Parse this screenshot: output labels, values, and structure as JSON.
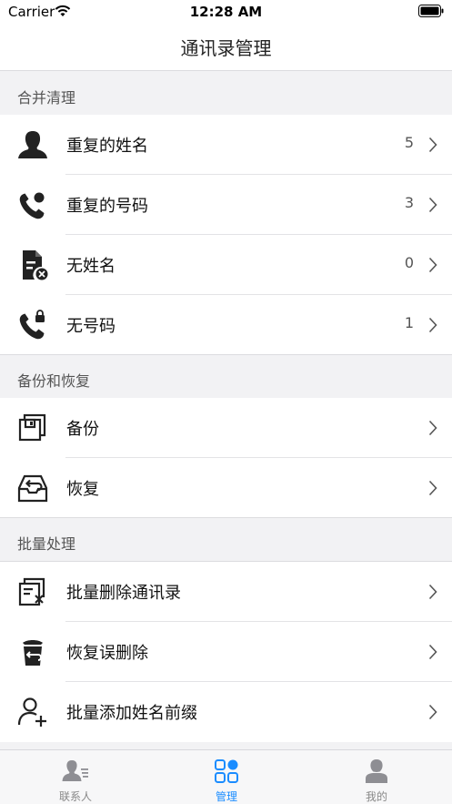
{
  "status_bar": {
    "carrier": "Carrier",
    "time": "12:28 AM"
  },
  "nav": {
    "title": "通讯录管理"
  },
  "sections": [
    {
      "header": "合并清理",
      "rows": [
        {
          "label": "重复的姓名",
          "count": "5",
          "icon": "person-icon"
        },
        {
          "label": "重复的号码",
          "count": "3",
          "icon": "phone-duplicate-icon"
        },
        {
          "label": "无姓名",
          "count": "0",
          "icon": "document-remove-icon"
        },
        {
          "label": "无号码",
          "count": "1",
          "icon": "phone-lock-icon"
        }
      ]
    },
    {
      "header": "备份和恢复",
      "rows": [
        {
          "label": "备份",
          "icon": "backup-icon"
        },
        {
          "label": "恢复",
          "icon": "restore-icon"
        }
      ]
    },
    {
      "header": "批量处理",
      "rows": [
        {
          "label": "批量删除通讯录",
          "icon": "batch-delete-icon"
        },
        {
          "label": "恢复误删除",
          "icon": "trash-restore-icon"
        },
        {
          "label": "批量添加姓名前缀",
          "icon": "add-person-icon"
        }
      ]
    }
  ],
  "tabs": [
    {
      "label": "联系人",
      "icon": "contacts-icon",
      "active": false
    },
    {
      "label": "管理",
      "icon": "grid-icon",
      "active": true
    },
    {
      "label": "我的",
      "icon": "profile-icon",
      "active": false
    }
  ],
  "colors": {
    "accent": "#1a8cff",
    "background": "#f2f2f4",
    "icon": "#222222"
  }
}
